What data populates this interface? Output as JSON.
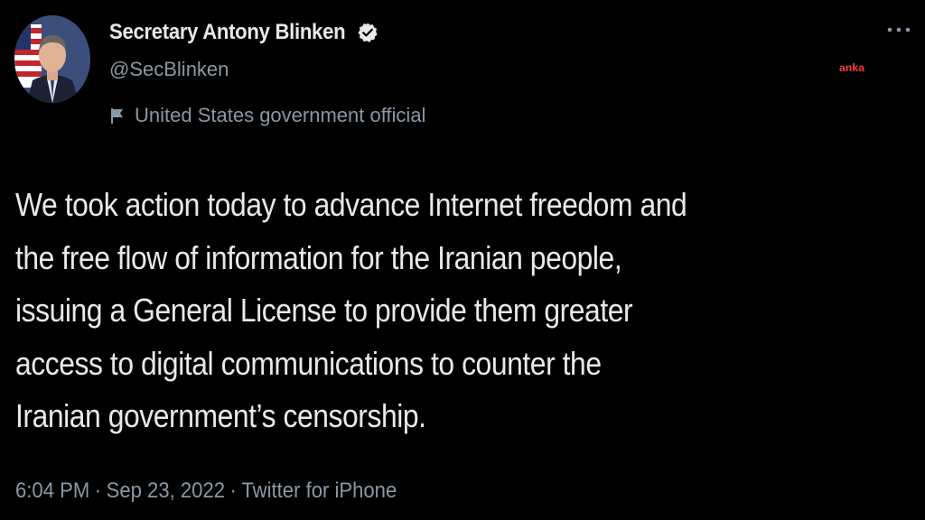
{
  "author": {
    "display_name": "Secretary Antony Blinken",
    "handle": "@SecBlinken",
    "label": "United States government official",
    "verified_icon": "verified-badge-icon",
    "avatar_icon": "avatar"
  },
  "watermark": "anka",
  "tweet": {
    "lines": [
      "We took action today to advance Internet freedom and",
      "the free flow of information for the Iranian people,",
      "issuing a General License to provide them greater",
      "access to digital communications to counter the",
      "Iranian government’s censorship."
    ]
  },
  "meta": {
    "time": "6:04 PM",
    "separator": "·",
    "date": "Sep 23, 2022",
    "source": "Twitter for iPhone"
  },
  "colors": {
    "background": "#000000",
    "primary_text": "#e7e9ea",
    "secondary_text": "#8b98a5",
    "watermark": "#ff3b3b"
  }
}
